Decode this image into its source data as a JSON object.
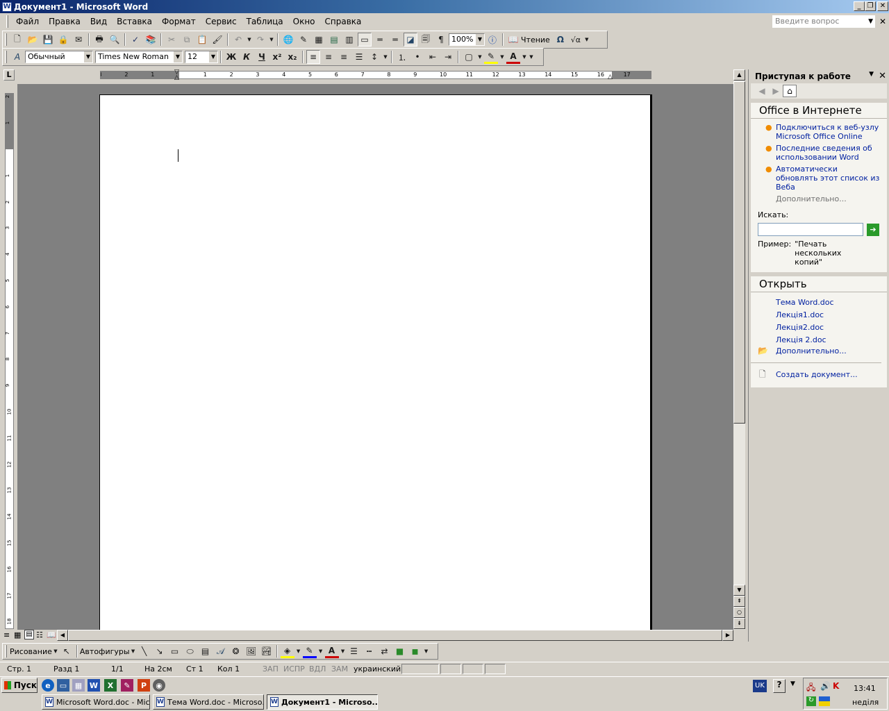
{
  "window": {
    "title": "Документ1 - Microsoft Word",
    "app_icon": "word-doc-icon",
    "min_label": "_",
    "max_label": "❐",
    "close_label": "✕"
  },
  "menu": {
    "items": [
      "Файл",
      "Правка",
      "Вид",
      "Вставка",
      "Формат",
      "Сервис",
      "Таблица",
      "Окно",
      "Справка"
    ],
    "ask_placeholder": "Введите вопрос",
    "doc_close_label": "✕"
  },
  "standard_toolbar": {
    "zoom": "100%",
    "reading_label": "Чтение",
    "omega": "Ω",
    "sqrt": "√α"
  },
  "formatting_toolbar": {
    "style": "Обычный",
    "font": "Times New Roman",
    "size": "12",
    "bold": "Ж",
    "italic": "К",
    "underline": "Ч",
    "superscript": "x²",
    "subscript": "x₂",
    "font_color_letter": "A"
  },
  "ruler": {
    "corner": "L",
    "h_labels": [
      "3",
      "2",
      "1",
      "",
      "1",
      "2",
      "3",
      "4",
      "5",
      "6",
      "7",
      "8",
      "9",
      "10",
      "11",
      "12",
      "13",
      "14",
      "15",
      "16",
      "17"
    ],
    "v_labels": [
      "2",
      "1",
      "",
      "1",
      "2",
      "3",
      "4",
      "5",
      "6",
      "7",
      "8",
      "9",
      "10",
      "11",
      "12",
      "13",
      "14",
      "15",
      "16",
      "17",
      "18"
    ]
  },
  "task_pane": {
    "title": "Приступая к работе",
    "office_online": {
      "title": "Office в Интернете",
      "links": [
        "Подключиться к веб-узлу Microsoft Office Online",
        "Последние сведения об использовании Word",
        "Автоматически обновлять этот список из Веба"
      ],
      "more": "Дополнительно..."
    },
    "search": {
      "label": "Искать:",
      "value": "",
      "go_icon": "➔",
      "example_prefix": "Пример:",
      "example_text": "\"Печать нескольких копий\""
    },
    "open": {
      "title": "Открыть",
      "files": [
        "Тема Word.doc",
        "Лекція1.doc",
        "Лекція2.doc",
        "Лекція 2.doc"
      ],
      "more": "Дополнительно...",
      "create": "Создать документ..."
    }
  },
  "drawing_toolbar": {
    "drawing_label": "Рисование",
    "autoshapes_label": "Автофигуры"
  },
  "status_bar": {
    "page": "Стр. 1",
    "section": "Разд 1",
    "pages": "1/1",
    "at": "На 2см",
    "line": "Ст 1",
    "col": "Кол 1",
    "rec": "ЗАП",
    "trk": "ИСПР",
    "ext": "ВДЛ",
    "ovr": "ЗАМ",
    "language": "украинский"
  },
  "taskbar": {
    "start_label": "Пуск",
    "buttons": [
      "Microsoft Word.doc - Mic...",
      "Тема Word.doc - Microso...",
      "Документ1 - Microso..."
    ],
    "active_index": 2,
    "language": "UK",
    "time": "13:41",
    "day": "неділя"
  }
}
